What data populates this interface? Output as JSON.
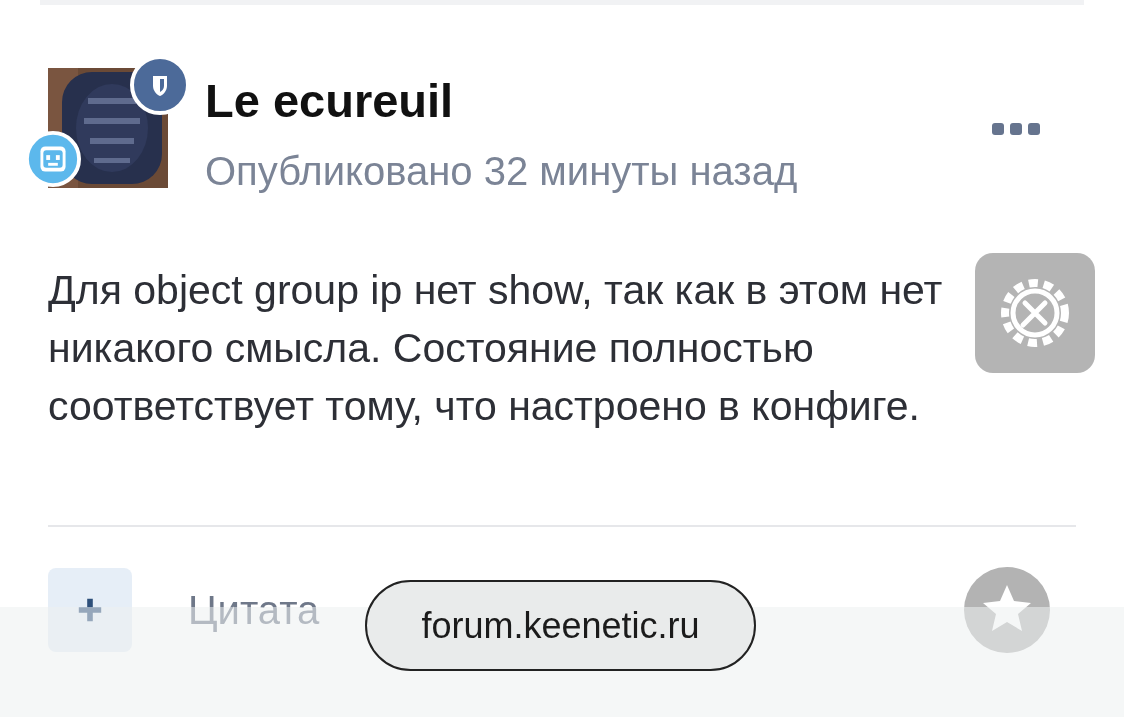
{
  "post": {
    "author": "Le ecureuil",
    "meta": "Опубликовано 32 минуты назад",
    "body": "Для object group ip нет show, так как в этом нет никакого смысла. Состояние полностью соответствует тому, что настроено в конфиге."
  },
  "actions": {
    "quote_label": "Цитата"
  },
  "browser_bar": {
    "url": "forum.keenetic.ru"
  }
}
